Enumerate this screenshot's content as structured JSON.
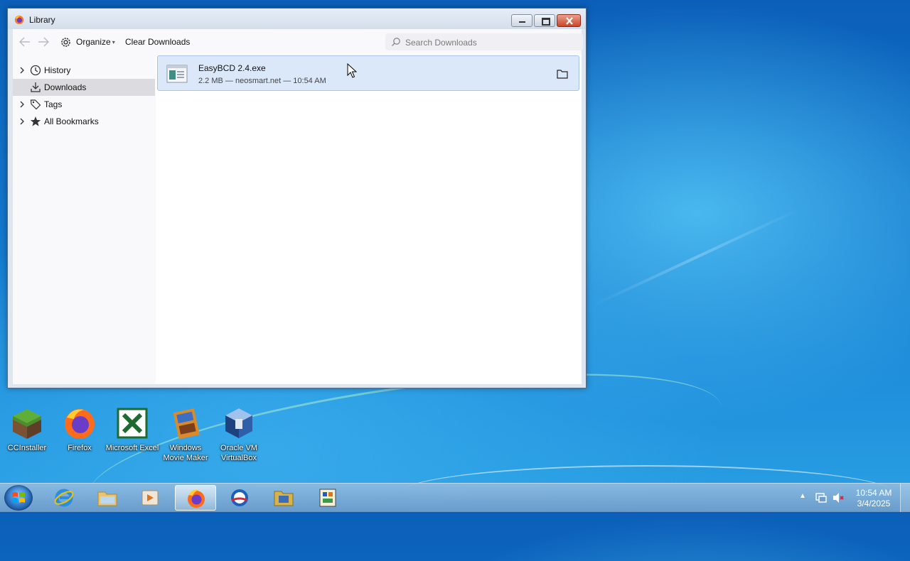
{
  "window": {
    "title": "Library",
    "toolbar": {
      "organize_label": "Organize",
      "clear_downloads_label": "Clear Downloads",
      "search_placeholder": "Search Downloads"
    },
    "sidebar": {
      "items": [
        {
          "label": "History",
          "icon": "clock-icon",
          "expandable": true,
          "selected": false
        },
        {
          "label": "Downloads",
          "icon": "download-icon",
          "expandable": false,
          "selected": true
        },
        {
          "label": "Tags",
          "icon": "tag-icon",
          "expandable": true,
          "selected": false
        },
        {
          "label": "All Bookmarks",
          "icon": "star-icon",
          "expandable": true,
          "selected": false
        }
      ]
    },
    "downloads": [
      {
        "name": "EasyBCD 2.4.exe",
        "details": "2.2 MB — neosmart.net — 10:54 AM",
        "icon": "exe-file-icon"
      }
    ]
  },
  "desktop": {
    "icons": [
      {
        "label": "CCInstaller",
        "icon": "minecraft-grass-block-icon"
      },
      {
        "label": "Firefox",
        "icon": "firefox-icon"
      },
      {
        "label": "Microsoft Excel",
        "icon": "excel-icon"
      },
      {
        "label": "Windows Movie Maker",
        "icon": "movie-maker-icon"
      },
      {
        "label": "Oracle VM VirtualBox",
        "icon": "virtualbox-icon"
      }
    ]
  },
  "taskbar": {
    "pinned": [
      {
        "name": "Internet Explorer",
        "icon": "internet-explorer-icon",
        "active": false
      },
      {
        "name": "Windows Explorer",
        "icon": "folder-icon",
        "active": false
      },
      {
        "name": "Media Player",
        "icon": "media-player-icon",
        "active": false
      },
      {
        "name": "Firefox",
        "icon": "firefox-icon",
        "active": true
      },
      {
        "name": "Obama app",
        "icon": "obama-logo-icon",
        "active": false
      },
      {
        "name": "File manager",
        "icon": "folder-tool-icon",
        "active": false
      },
      {
        "name": "Control panel",
        "icon": "control-panel-icon",
        "active": false
      }
    ],
    "clock": {
      "time": "10:54 AM",
      "date": "3/4/2025"
    }
  },
  "colors": {
    "selection_bg": "#dbe8f9",
    "selection_border": "#a9c4e8",
    "sidebar_selected": "#dcdce0",
    "close_button": "#c9472b"
  }
}
